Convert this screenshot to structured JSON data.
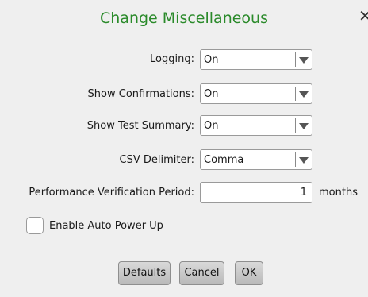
{
  "dialog": {
    "title": "Change Miscellaneous",
    "close_icon": "close-icon"
  },
  "fields": {
    "logging": {
      "label": "Logging:",
      "value": "On"
    },
    "show_confirmations": {
      "label": "Show Confirmations:",
      "value": "On"
    },
    "show_test_summary": {
      "label": "Show Test Summary:",
      "value": "On"
    },
    "csv_delimiter": {
      "label": "CSV Delimiter:",
      "value": "Comma"
    },
    "performance_verification_period": {
      "label": "Performance Verification Period:",
      "value": "1",
      "unit": "months"
    }
  },
  "enable_auto_power_up": {
    "label": "Enable Auto Power Up",
    "checked": false
  },
  "buttons": {
    "defaults": "Defaults",
    "cancel": "Cancel",
    "ok": "OK"
  },
  "colors": {
    "title": "#2a8a2a",
    "background": "#efefef"
  }
}
